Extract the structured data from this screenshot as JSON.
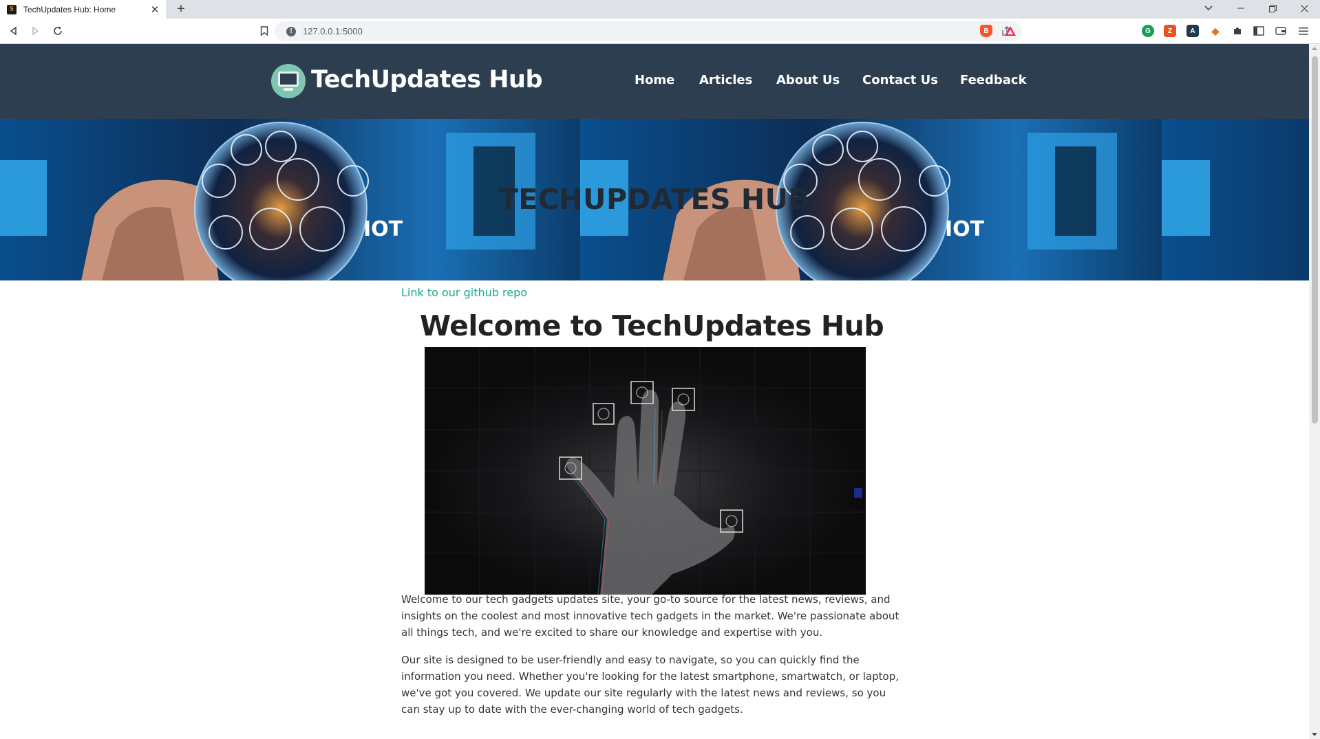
{
  "browser": {
    "tab_title": "TechUpdates Hub: Home",
    "favicon_letter": "S",
    "url": "127.0.0.1:5000",
    "new_tab_symbol": "+",
    "close_symbol": "✕"
  },
  "header": {
    "site_title": "TechUpdates Hub",
    "nav": [
      "Home",
      "Articles",
      "About Us",
      "Contact Us",
      "Feedback"
    ]
  },
  "hero": {
    "title": "TECHUPDATES HUB",
    "badge": "IOT"
  },
  "main": {
    "repo_link": "Link to our github repo",
    "heading": "Welcome to TechUpdates Hub",
    "paragraphs": [
      "Welcome to our tech gadgets updates site, your go-to source for the latest news, reviews, and insights on the coolest and most innovative tech gadgets in the market. We're passionate about all things tech, and we're excited to share our knowledge and expertise with you.",
      "Our site is designed to be user-friendly and easy to navigate, so you can quickly find the information you need. Whether you're looking for the latest smartphone, smartwatch, or laptop, we've got you covered. We update our site regularly with the latest news and reviews, so you can stay up to date with the ever-changing world of tech gadgets."
    ]
  },
  "colors": {
    "header_bg": "#2c3e50",
    "link": "#1aa98b",
    "heading": "#222222"
  }
}
